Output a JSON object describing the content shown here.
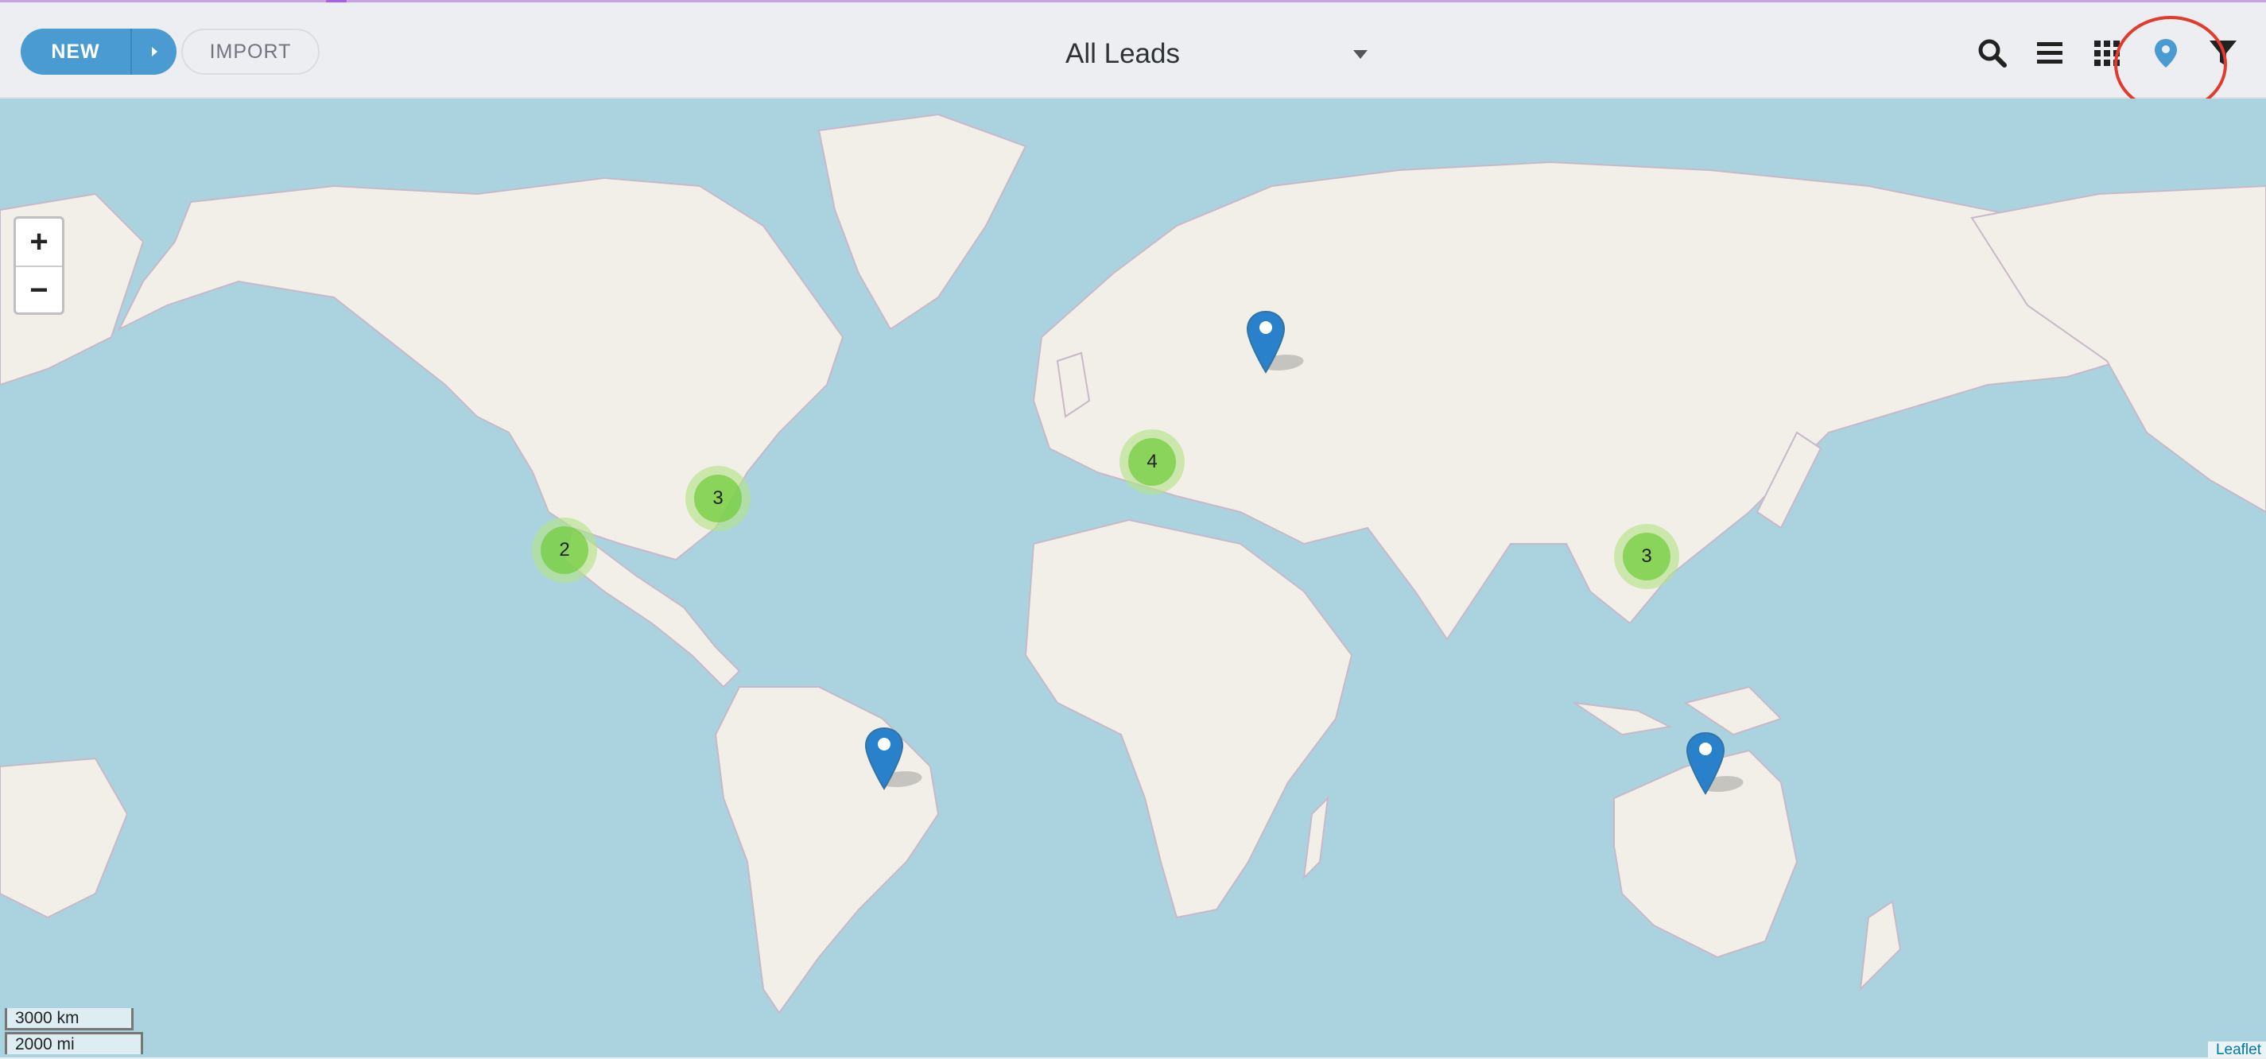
{
  "toolbar": {
    "new_label": "NEW",
    "import_label": "IMPORT",
    "view_title": "All Leads",
    "accent_color": "#4a9bd1",
    "highlight_color": "#e43a2c",
    "icons": [
      "search-icon",
      "list-view-icon",
      "grid-view-icon",
      "map-pin-icon",
      "filter-icon"
    ]
  },
  "map": {
    "zoom_in_label": "+",
    "zoom_out_label": "−",
    "clusters": [
      {
        "region": "US West Coast",
        "count": "2"
      },
      {
        "region": "US Northeast",
        "count": "3"
      },
      {
        "region": "Europe",
        "count": "4"
      },
      {
        "region": "East China",
        "count": "3"
      }
    ],
    "markers": [
      {
        "region": "Russia"
      },
      {
        "region": "Brazil"
      },
      {
        "region": "Australia"
      }
    ],
    "scale_km": "3000 km",
    "scale_mi": "2000 mi",
    "attribution": "Leaflet",
    "water_color": "#aad3df",
    "land_color": "#f2efe9",
    "cluster_color": "#6ecc39",
    "marker_color": "#2a81cb"
  }
}
